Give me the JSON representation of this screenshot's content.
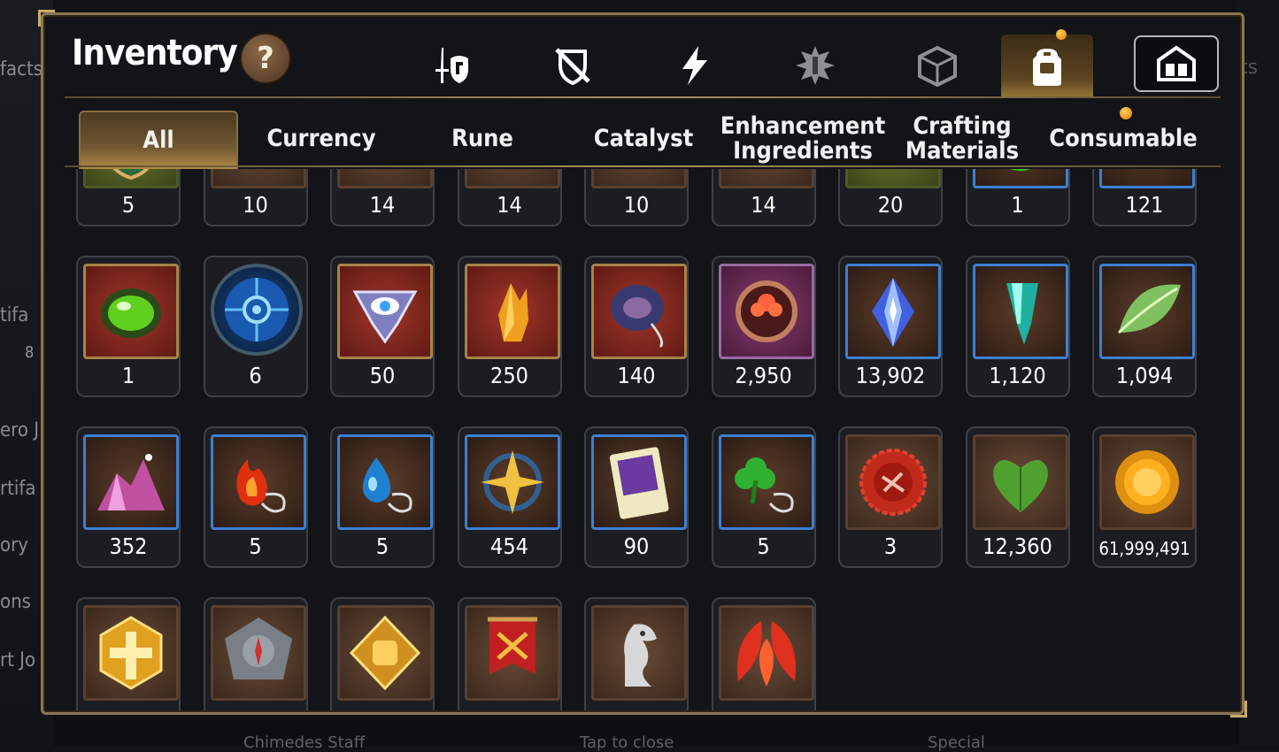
{
  "background": {
    "left_fragments": [
      "facts",
      "tifa",
      "8",
      "ero J",
      "rtifa",
      "ory",
      "ons",
      "rt Jo"
    ],
    "right_fragment": "ts",
    "bottom_fragments": [
      "Chimedes Staff",
      "Tap to close",
      "Special"
    ]
  },
  "header": {
    "title": "Inventory",
    "help_label": "?"
  },
  "category_tabs": [
    {
      "icon": "hero-sword-shield-icon",
      "active": false
    },
    {
      "icon": "broken-shield-icon",
      "active": false
    },
    {
      "icon": "lightning-icon",
      "active": false
    },
    {
      "icon": "artifact-crest-icon",
      "active": false
    },
    {
      "icon": "cube-icon",
      "active": false
    },
    {
      "icon": "backpack-icon",
      "active": true,
      "notification": true
    },
    {
      "icon": "storage-house-icon",
      "active": false
    }
  ],
  "sub_tabs": [
    {
      "label": "All",
      "active": true
    },
    {
      "label": "Currency",
      "active": false
    },
    {
      "label": "Rune",
      "active": false
    },
    {
      "label": "Catalyst",
      "active": false
    },
    {
      "label": "Enhancement Ingredients",
      "active": false
    },
    {
      "label": "Crafting Materials",
      "active": false
    },
    {
      "label": "Consumable",
      "active": false,
      "notification": true
    }
  ],
  "items": [
    {
      "qty": "5",
      "icon": "crest-shield-icon",
      "frame": "green"
    },
    {
      "qty": "10",
      "icon": "purple-rune-icon",
      "frame": "brown"
    },
    {
      "qty": "14",
      "icon": "orange-rune-icon",
      "frame": "brown"
    },
    {
      "qty": "14",
      "icon": "cyan-rune-icon",
      "frame": "brown"
    },
    {
      "qty": "10",
      "icon": "yellow-rune-icon",
      "frame": "brown"
    },
    {
      "qty": "14",
      "icon": "green-rune-icon",
      "frame": "brown"
    },
    {
      "qty": "20",
      "icon": "claw-icon",
      "frame": "green"
    },
    {
      "qty": "1",
      "icon": "green-slime-icon",
      "frame": "blue"
    },
    {
      "qty": "121",
      "icon": "leaf-branch-icon",
      "frame": "blue"
    },
    {
      "qty": "1",
      "icon": "green-orb-icon",
      "frame": "red"
    },
    {
      "qty": "6",
      "icon": "blue-rune-disc-icon",
      "frame": "round"
    },
    {
      "qty": "50",
      "icon": "eye-crest-icon",
      "frame": "red"
    },
    {
      "qty": "250",
      "icon": "amber-crystal-icon",
      "frame": "red"
    },
    {
      "qty": "140",
      "icon": "ring-pendant-icon",
      "frame": "red"
    },
    {
      "qty": "2,950",
      "icon": "flower-ring-icon",
      "frame": "purple"
    },
    {
      "qty": "13,902",
      "icon": "blue-gem-icon",
      "frame": "blue"
    },
    {
      "qty": "1,120",
      "icon": "teal-crystal-icon",
      "frame": "blue"
    },
    {
      "qty": "1,094",
      "icon": "green-leaf-icon",
      "frame": "blue"
    },
    {
      "qty": "352",
      "icon": "pink-crystal-pile-icon",
      "frame": "blue"
    },
    {
      "qty": "5",
      "icon": "fire-pendant-icon",
      "frame": "blue"
    },
    {
      "qty": "5",
      "icon": "water-pendant-icon",
      "frame": "blue"
    },
    {
      "qty": "454",
      "icon": "star-compass-icon",
      "frame": "blue"
    },
    {
      "qty": "90",
      "icon": "ticket-card-icon",
      "frame": "blue"
    },
    {
      "qty": "5",
      "icon": "clover-pendant-icon",
      "frame": "blue"
    },
    {
      "qty": "3",
      "icon": "red-seal-icon",
      "frame": "brown"
    },
    {
      "qty": "12,360",
      "icon": "green-heart-icon",
      "frame": "brown"
    },
    {
      "qty": "61,999,491",
      "icon": "gold-coin-icon",
      "frame": "brown"
    },
    {
      "qty": "",
      "icon": "gold-cross-badge-icon",
      "frame": "brown"
    },
    {
      "qty": "",
      "icon": "stone-compass-icon",
      "frame": "brown"
    },
    {
      "qty": "",
      "icon": "fist-badge-icon",
      "frame": "brown"
    },
    {
      "qty": "",
      "icon": "war-banner-icon",
      "frame": "brown"
    },
    {
      "qty": "",
      "icon": "silver-horse-icon",
      "frame": "brown"
    },
    {
      "qty": "",
      "icon": "red-leaves-icon",
      "frame": "brown"
    }
  ],
  "colors": {
    "panel_border": "#8b7650",
    "active_tab": "#9a7a3a",
    "frame_blue": "#3d7fd0",
    "frame_red": "#a8824a"
  }
}
